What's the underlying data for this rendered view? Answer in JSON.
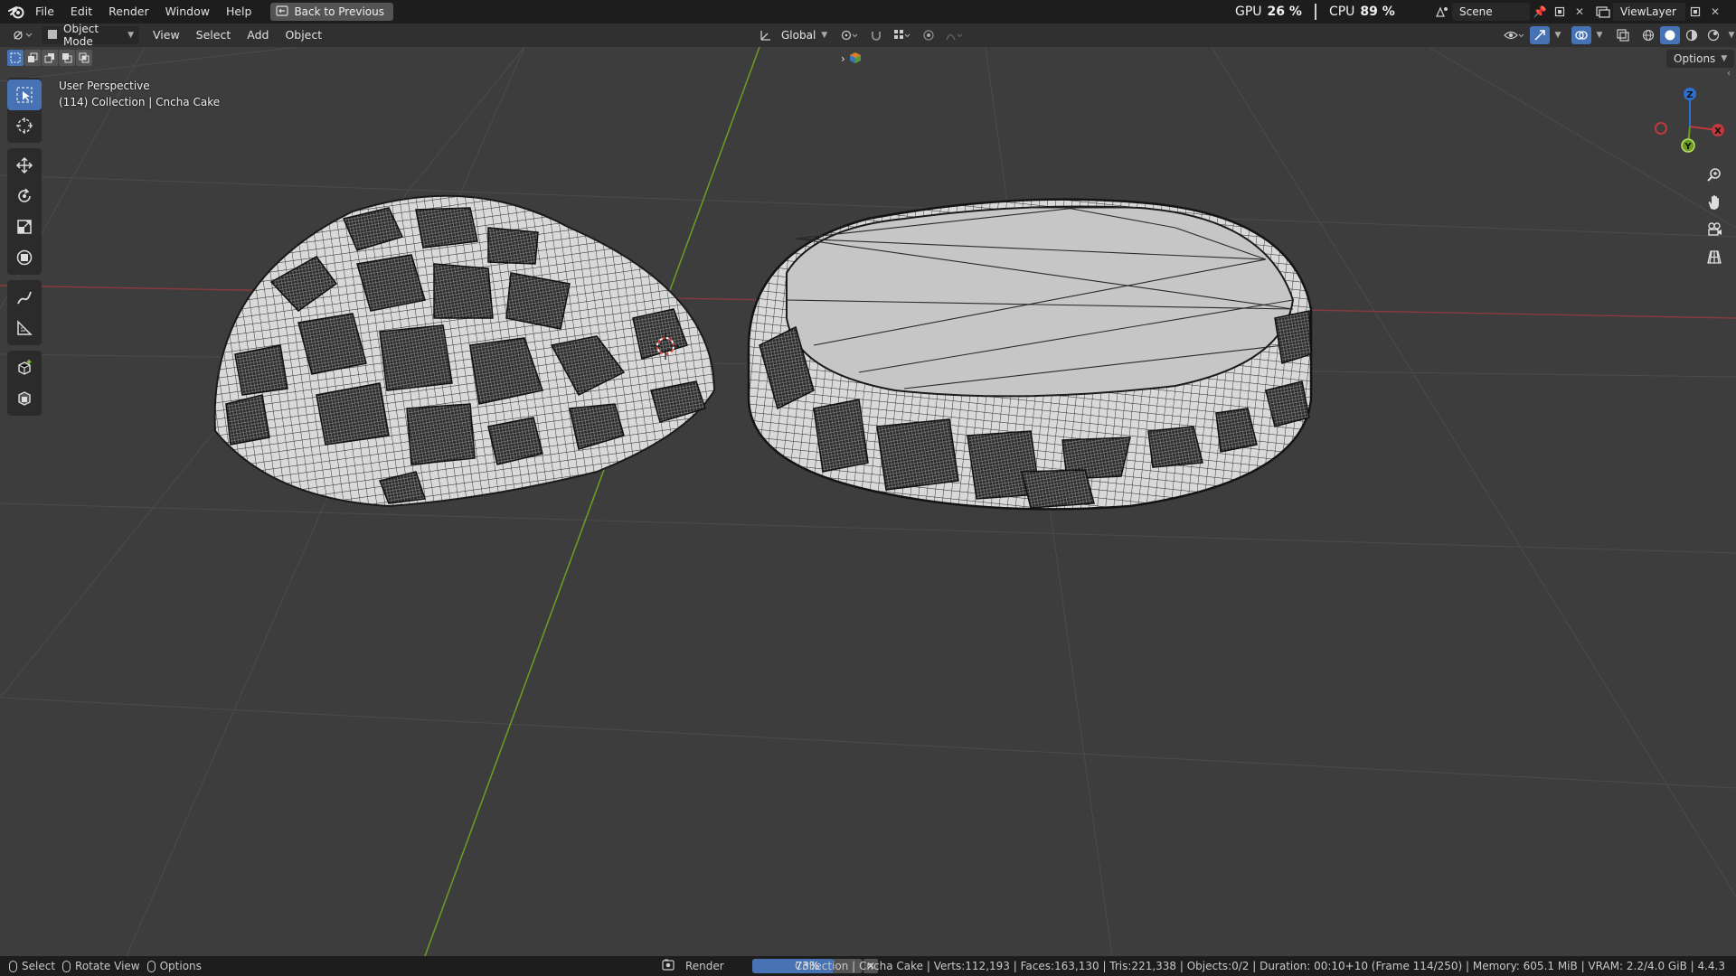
{
  "menu": {
    "items": [
      "File",
      "Edit",
      "Render",
      "Window",
      "Help"
    ],
    "back_button": "Back to Previous"
  },
  "perf": {
    "gpu_label": "GPU",
    "gpu_value": "26 %",
    "cpu_label": "CPU",
    "cpu_value": "89 %"
  },
  "scene": {
    "scene_name": "Scene",
    "view_layer": "ViewLayer"
  },
  "viewport_header": {
    "mode": "Object Mode",
    "menus": [
      "View",
      "Select",
      "Add",
      "Object"
    ],
    "transform_orientation": "Global",
    "options_label": "Options"
  },
  "overlay": {
    "view_name": "User Perspective",
    "collection_info": "(114) Collection | Cncha Cake"
  },
  "gizmo": {
    "z": "Z",
    "x": "X",
    "y": "Y"
  },
  "status": {
    "hint_select": "Select",
    "hint_rotate": "Rotate View",
    "hint_options": "Options",
    "render_label": "Render",
    "progress_text": "73%",
    "progress_fraction": 0.73,
    "stats": "Collection | Cncha Cake | Verts:112,193 | Faces:163,130 | Tris:221,338 | Objects:0/2 | Duration: 00:10+10 (Frame 114/250) | Memory: 605.1 MiB | VRAM: 2.2/4.0 GiB | 4.4.3"
  },
  "colors": {
    "accent": "#4772b3",
    "x_axis": "#c0393f",
    "y_axis": "#6a9a22",
    "z_axis": "#2f6fcf",
    "background": "#3d3d3d"
  }
}
